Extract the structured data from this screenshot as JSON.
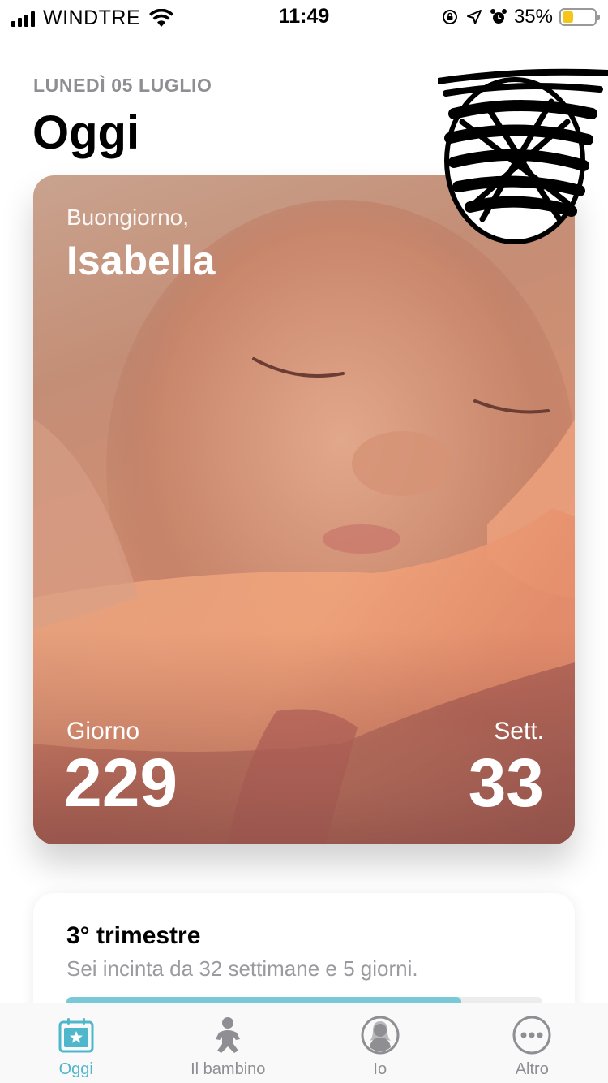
{
  "status_bar": {
    "carrier": "WINDTRE",
    "time": "11:49",
    "battery_percent": "35%",
    "battery_level": 0.35,
    "battery_color": "#f5c518"
  },
  "header": {
    "date": "LUNEDÌ 05 LUGLIO",
    "title": "Oggi"
  },
  "hero": {
    "greeting": "Buongiorno,",
    "name": "Isabella",
    "day_label": "Giorno",
    "day_value": "229",
    "week_label": "Sett.",
    "week_value": "33"
  },
  "trimester": {
    "title": "3° trimestre",
    "subtitle": "Sei incinta da 32 settimane e 5 giorni.",
    "progress": 0.83,
    "accent": "#78c8d6"
  },
  "tab_bar": {
    "active_color": "#4fb7cc",
    "inactive_color": "#8e8e93",
    "tabs": [
      {
        "label": "Oggi",
        "icon": "calendar-star-icon"
      },
      {
        "label": "Il bambino",
        "icon": "baby-icon"
      },
      {
        "label": "Io",
        "icon": "profile-icon"
      },
      {
        "label": "Altro",
        "icon": "more-icon"
      }
    ]
  }
}
